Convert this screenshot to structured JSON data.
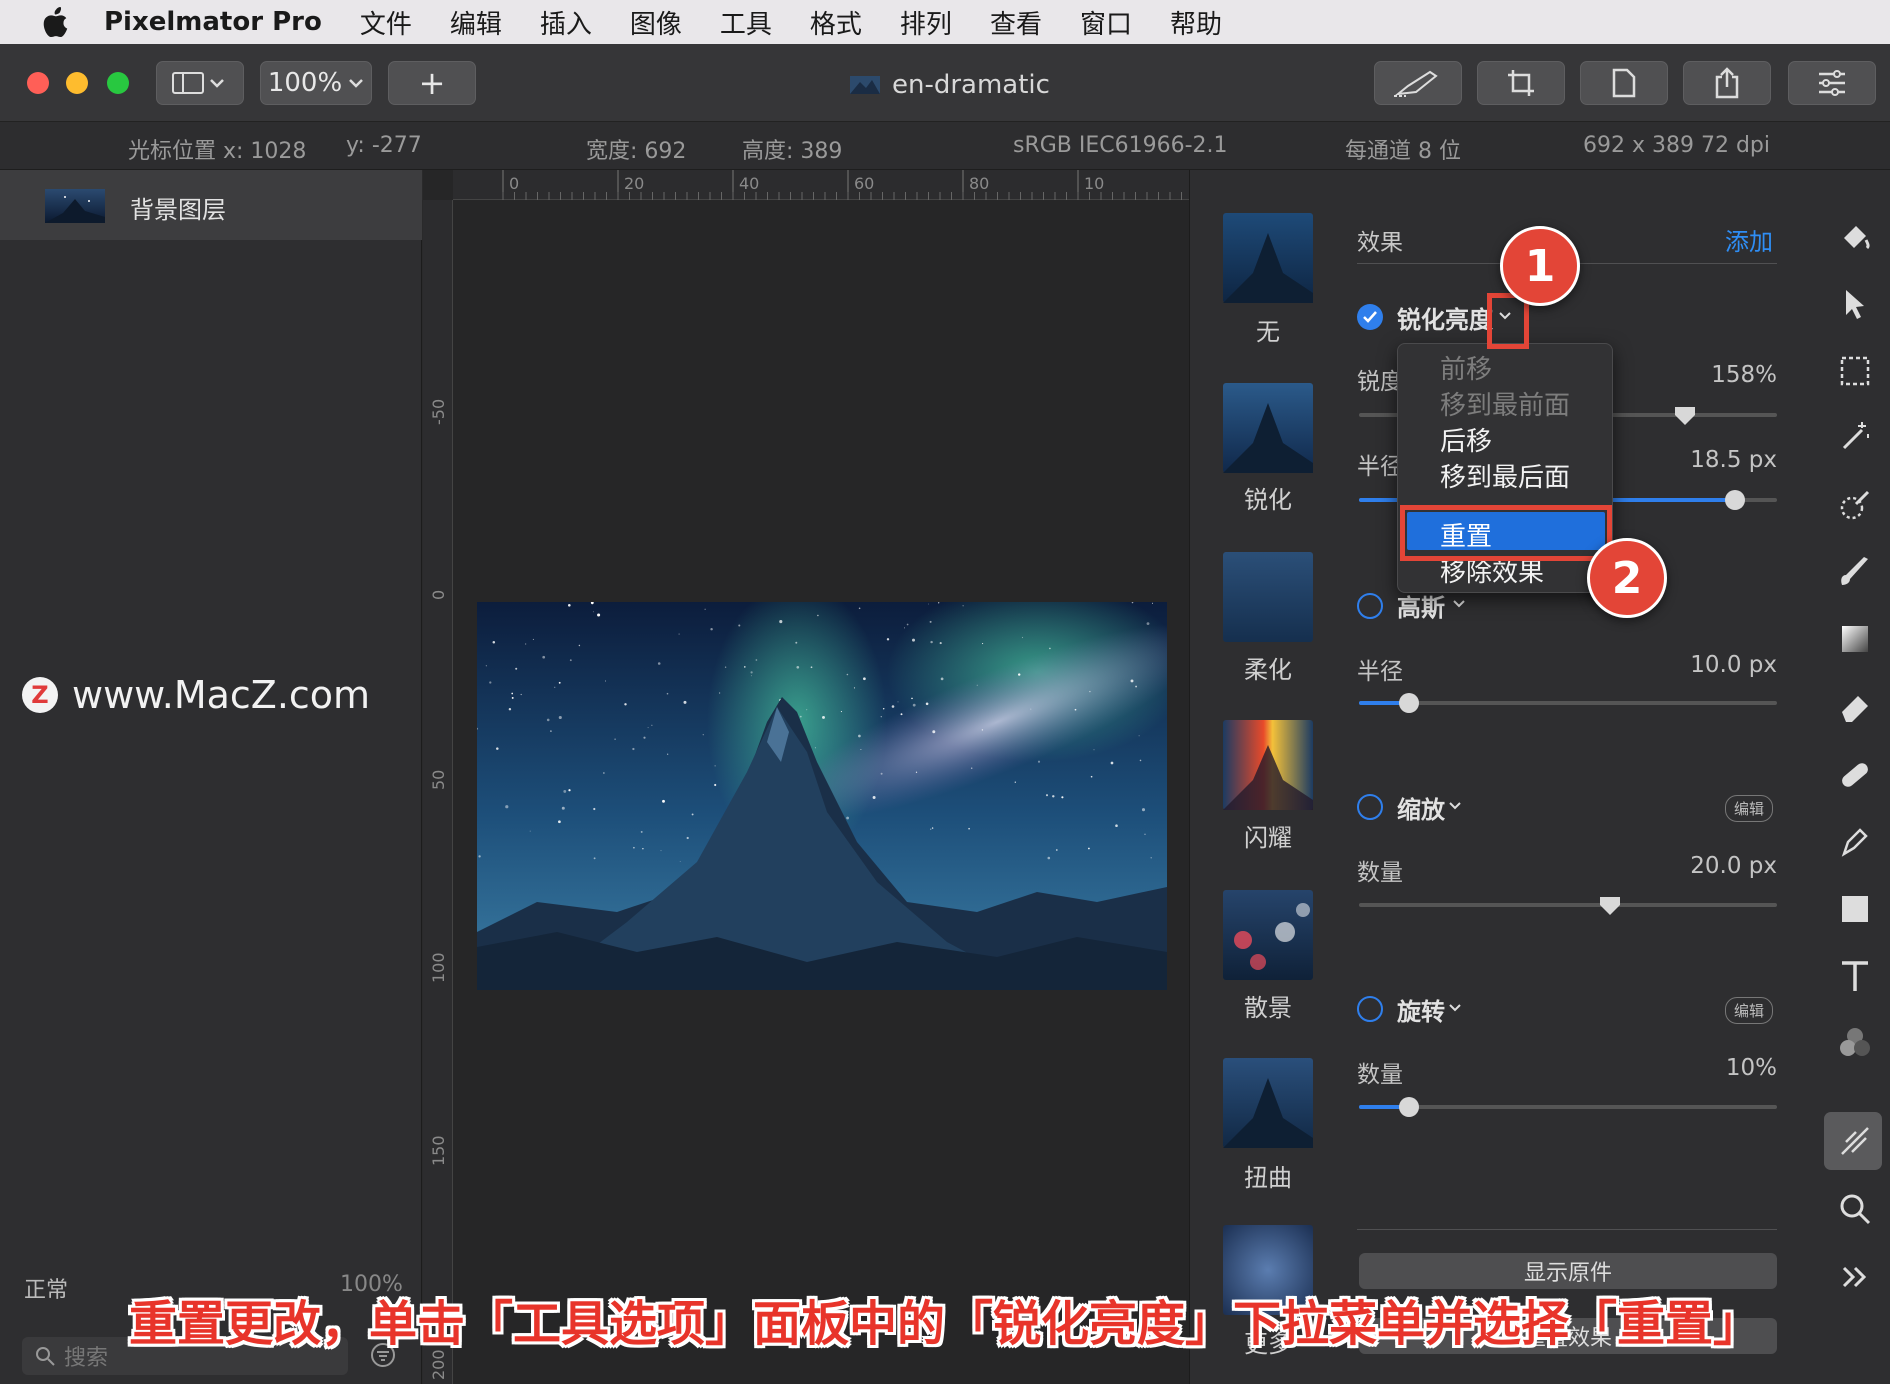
{
  "menubar": {
    "app_name": "Pixelmator Pro",
    "items": [
      "文件",
      "编辑",
      "插入",
      "图像",
      "工具",
      "格式",
      "排列",
      "查看",
      "窗口",
      "帮助"
    ]
  },
  "toolbar": {
    "zoom": "100%",
    "add_label": "+",
    "doc_title": "en-dramatic",
    "icons": [
      "sidebar-toggle-icon",
      "zoom-chevron-icon",
      "brush-icon",
      "crop-icon",
      "document-icon",
      "share-icon",
      "settings-sliders-icon"
    ]
  },
  "infobar": {
    "cursor_x": "光标位置 x: 1028",
    "cursor_y": "y: -277",
    "width": "宽度: 692",
    "height": "高度: 389",
    "color_profile": "sRGB IEC61966-2.1",
    "bits": "每通道 8 位",
    "size": "692 x 389 72 dpi"
  },
  "layers": {
    "items": [
      {
        "name": "背景图层"
      }
    ],
    "blend_mode": "正常",
    "opacity": "100%",
    "search_placeholder": "搜索"
  },
  "watermark": {
    "logo": "Z",
    "text": "www.MacZ.com"
  },
  "ruler": {
    "h_ticks": [
      "0",
      "20",
      "40",
      "60",
      "80",
      "10"
    ],
    "v_ticks": [
      "-50",
      "0",
      "50",
      "100",
      "150",
      "200"
    ]
  },
  "presets": [
    "无",
    "锐化",
    "柔化",
    "闪耀",
    "散景",
    "扭曲",
    "更多"
  ],
  "effects": {
    "title": "效果",
    "add_label": "添加",
    "sharpen": {
      "name": "锐化亮度",
      "enabled": true,
      "params": [
        {
          "label": "锐度",
          "value": "158%",
          "level": 0.78
        },
        {
          "label": "半径",
          "value": "18.5 px",
          "level": 0.9
        }
      ]
    },
    "gaussian": {
      "name": "高斯",
      "enabled": false,
      "param": {
        "label": "半径",
        "value": "10.0 px",
        "level": 0.12
      }
    },
    "zoom": {
      "name": "缩放",
      "enabled": false,
      "edit_label": "编辑",
      "param": {
        "label": "数量",
        "value": "20.0 px",
        "level": 0.6
      }
    },
    "rotate": {
      "name": "旋转",
      "enabled": false,
      "edit_label": "编辑",
      "param": {
        "label": "数量",
        "value": "10%",
        "level": 0.12
      }
    },
    "show_original_label": "显示原件",
    "reset_effects_label": "重置效果"
  },
  "dropdown": {
    "items": [
      {
        "label": "前移",
        "enabled": false
      },
      {
        "label": "移到最前面",
        "enabled": false
      },
      {
        "label": "后移",
        "enabled": true
      },
      {
        "label": "移到最后面",
        "enabled": true
      },
      {
        "label": "重置",
        "enabled": true,
        "selected": true
      },
      {
        "label": "移除效果",
        "enabled": true
      }
    ]
  },
  "tools": [
    "paint-bucket-icon",
    "arrow-icon",
    "rect-select-icon",
    "magic-wand-icon",
    "color-picker-icon",
    "brush-icon",
    "gradient-icon",
    "eraser-icon",
    "bandage-icon",
    "pen-icon",
    "shape-icon",
    "text-icon",
    "color-adjust-icon",
    "effects-icon",
    "zoom-icon",
    "more-tools-icon"
  ],
  "annotations": {
    "callouts": [
      "1",
      "2"
    ],
    "caption": "重置更改，单击「工具选项」面板中的「锐化亮度」下拉菜单并选择「重置」"
  },
  "colors": {
    "accent": "#2f7fec",
    "callout_red": "#e34537",
    "traffic_red": "#ff5f57",
    "traffic_yellow": "#febc2e",
    "traffic_green": "#28c840"
  }
}
